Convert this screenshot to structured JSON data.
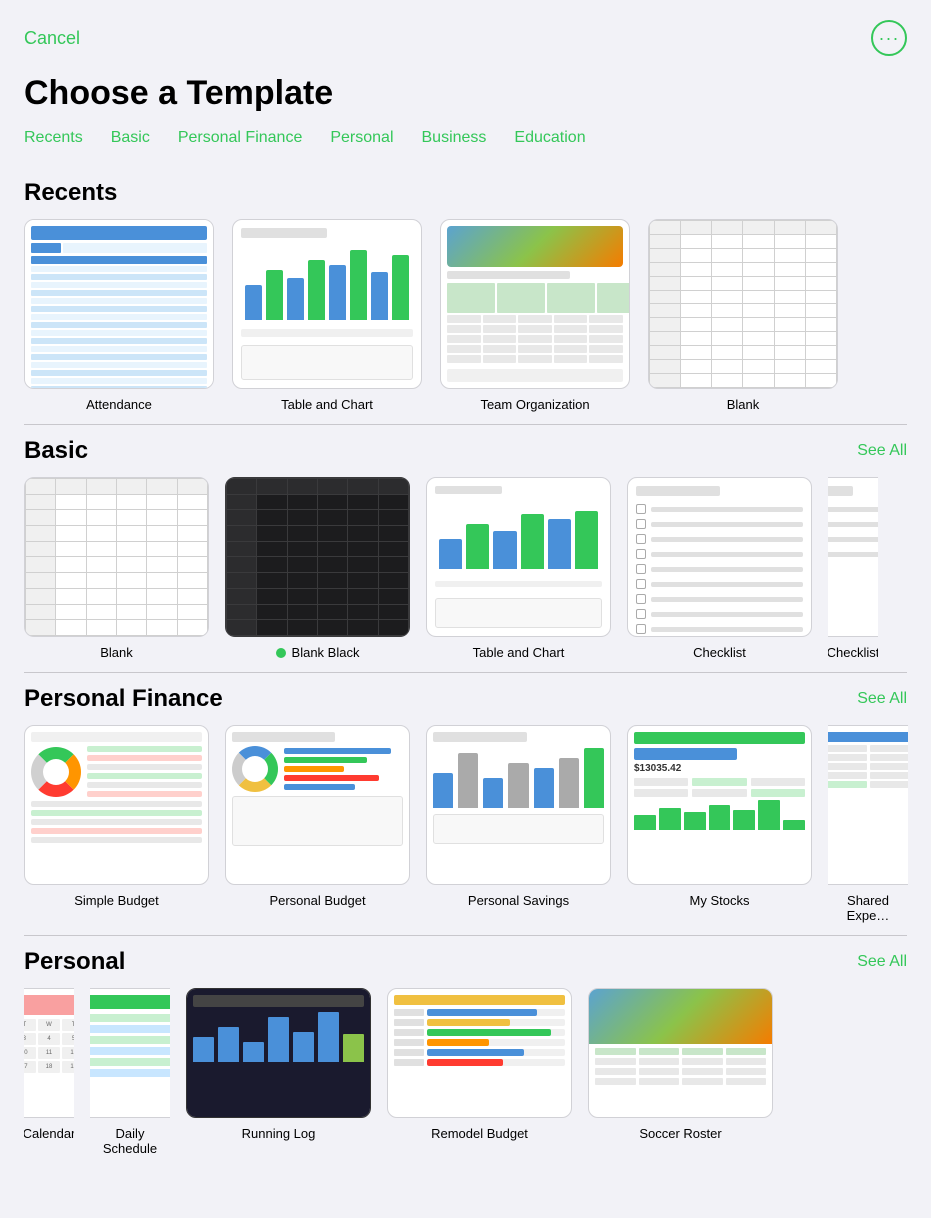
{
  "header": {
    "cancel_label": "Cancel",
    "more_icon": "···"
  },
  "page": {
    "title": "Choose a Template"
  },
  "nav": {
    "tabs": [
      {
        "id": "recents",
        "label": "Recents"
      },
      {
        "id": "basic",
        "label": "Basic"
      },
      {
        "id": "personal-finance",
        "label": "Personal Finance"
      },
      {
        "id": "personal",
        "label": "Personal"
      },
      {
        "id": "business",
        "label": "Business"
      },
      {
        "id": "education",
        "label": "Education"
      }
    ]
  },
  "sections": {
    "recents": {
      "title": "Recents",
      "items": [
        {
          "id": "attendance",
          "label": "Attendance"
        },
        {
          "id": "table-and-chart",
          "label": "Table and Chart"
        },
        {
          "id": "team-organization",
          "label": "Team Organization"
        },
        {
          "id": "blank",
          "label": "Blank"
        }
      ]
    },
    "basic": {
      "title": "Basic",
      "see_all": "See All",
      "items": [
        {
          "id": "blank",
          "label": "Blank",
          "dot": false
        },
        {
          "id": "blank-black",
          "label": "Blank Black",
          "dot": true
        },
        {
          "id": "table-and-chart",
          "label": "Table and Chart",
          "dot": false
        },
        {
          "id": "checklist",
          "label": "Checklist",
          "dot": false
        },
        {
          "id": "checklist2",
          "label": "Checklist",
          "dot": false
        }
      ]
    },
    "personal_finance": {
      "title": "Personal Finance",
      "see_all": "See All",
      "items": [
        {
          "id": "simple-budget",
          "label": "Simple Budget"
        },
        {
          "id": "personal-budget",
          "label": "Personal Budget"
        },
        {
          "id": "personal-savings",
          "label": "Personal Savings"
        },
        {
          "id": "my-stocks",
          "label": "My Stocks"
        },
        {
          "id": "shared-expenses",
          "label": "Shared Expe…"
        }
      ]
    },
    "personal": {
      "title": "Personal",
      "see_all": "See All",
      "items": [
        {
          "id": "calendar",
          "label": "Calendar"
        },
        {
          "id": "daily-schedule",
          "label": "Daily Schedule"
        },
        {
          "id": "running-log",
          "label": "Running Log"
        },
        {
          "id": "remodel-budget",
          "label": "Remodel Budget"
        },
        {
          "id": "soccer-roster",
          "label": "Soccer Roster"
        }
      ]
    }
  },
  "colors": {
    "green": "#34c759",
    "blue": "#4a90d9",
    "accent": "#34c759"
  }
}
